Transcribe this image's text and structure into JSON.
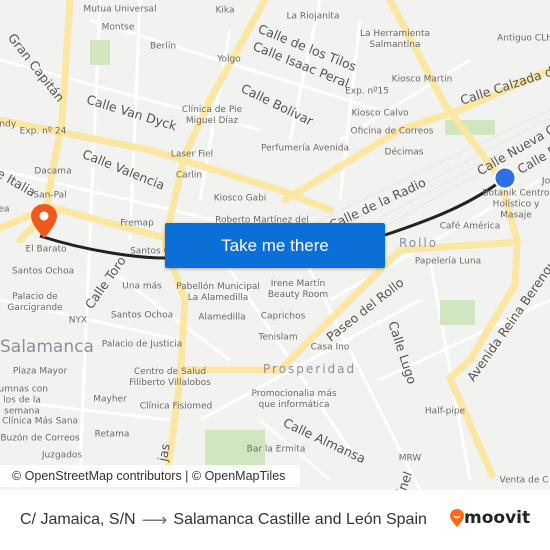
{
  "map": {
    "street_labels": [
      "Gran Capitán",
      "Calle Van Dyck",
      "Calle Valencia",
      "Calle de los Tilos",
      "Calle Isaac Peral",
      "Calle Bolívar",
      "Calle Calzada de",
      "Calle Nueva G",
      "Calle Bo",
      "Calle de la Radio",
      "Calle Toro",
      "Paseo del Rollo",
      "Calle Lugo",
      "Avenida Reina Berenguela",
      "Calle Almansa",
      "e Italia",
      "jas",
      "inel"
    ],
    "districts": [
      "Salamanca",
      "Prosperidad",
      "Rollo"
    ],
    "poi_labels": [
      "Mutua Universal",
      "Kika",
      "La Riojanita",
      "Montse",
      "Berlín",
      "Yolgo",
      "La Herramienta Salmantina",
      "Antiguo CLH",
      "Kiosco Martín",
      "Exp. nº15",
      "Kiosco Calvo",
      "Oficina de Correos",
      "Clínica de Pie Miguel Díaz",
      "Perfumería Avenida",
      "Décimas",
      "Laser Fiel",
      "Carlin",
      "Exp. nº 24",
      "endy",
      "Dacama",
      "San-Pal",
      "Kiosco Gabi",
      "Roberto Martínez del",
      "Fremap",
      "Botanik Centro Holístico y Masaje",
      "Jo",
      "Café América",
      "El Barato",
      "Santos Ochoa",
      "Santos C",
      "Papelería Luna",
      "Una más",
      "Pabellón Municipal La Alamedilla",
      "Irene Martín Beauty Room",
      "Palacio de Garcigrande",
      "NYX",
      "Santos Ochoa",
      "Alamedilla",
      "Caprichos",
      "Tenislam",
      "Palacio de Justicia",
      "Casa Ino",
      "Plaza Mayor",
      "Centro de Salud Filiberto Villalobos",
      "Promocionalia más que informática",
      "Mayher",
      "Clínica Fisiomed",
      "Half-pipe",
      "Clínica Más Sana",
      "Retama",
      "Buzón de Correos",
      "Bar la Ermita",
      "Juzgados",
      "MRW",
      "Venta de C",
      "lumnas con los de la semana",
      "ea"
    ],
    "icons": {
      "origin": "location-pin-icon",
      "destination": "current-location-dot-icon"
    },
    "colors": {
      "route": "#222222",
      "origin_pin": "#ef5a1c",
      "destination_dot": "#2f6fe6",
      "major_road": "#fbe6a2",
      "button": "#0a6fd6"
    }
  },
  "cta": {
    "label": "Take me there"
  },
  "attribution": "© OpenStreetMap contributors | © OpenMapTiles",
  "footer": {
    "origin": "C/ Jamaica, S/N",
    "arrow": "⟶",
    "destination": "Salamanca Castille and León Spain",
    "brand": "moovit",
    "brand_color": "#ff6a13"
  }
}
